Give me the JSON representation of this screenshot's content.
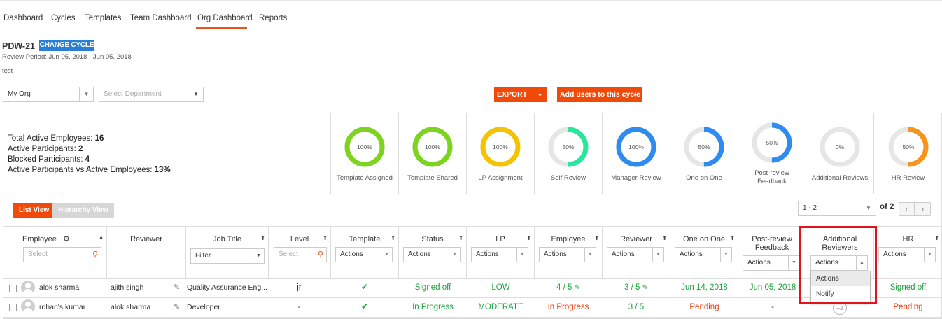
{
  "nav": {
    "tabs": [
      "Dashboard",
      "Cycles",
      "Templates",
      "Team Dashboard",
      "Org Dashboard",
      "Reports"
    ],
    "active": "Org Dashboard"
  },
  "cycle": {
    "name": "PDW-21",
    "change_label": "CHANGE CYCLE",
    "review_period": "Review Period: Jun 05, 2018 - Jun 05, 2018",
    "description": "test"
  },
  "filters": {
    "org_value": "My Org",
    "department_placeholder": "Select Department",
    "export_label": "EXPORT",
    "add_users_label": "Add users to this cycle"
  },
  "stats": [
    {
      "label": "Total Active Employees: ",
      "value": "16"
    },
    {
      "label": "Active Participants: ",
      "value": "2"
    },
    {
      "label": "Blocked Participants: ",
      "value": "4"
    },
    {
      "label": "Active Participants vs Active Employees: ",
      "value": "13%"
    }
  ],
  "metrics": [
    {
      "label": "Template Assigned",
      "pct": "100%",
      "fraction": 1.0,
      "color": "#7ed321"
    },
    {
      "label": "Template Shared",
      "pct": "100%",
      "fraction": 1.0,
      "color": "#7ed321"
    },
    {
      "label": "LP Assignment",
      "pct": "100%",
      "fraction": 1.0,
      "color": "#f5c300"
    },
    {
      "label": "Self Review",
      "pct": "50%",
      "fraction": 0.5,
      "color": "#27e89a"
    },
    {
      "label": "Manager Review",
      "pct": "100%",
      "fraction": 1.0,
      "color": "#2e8bf0"
    },
    {
      "label": "One on One",
      "pct": "50%",
      "fraction": 0.5,
      "color": "#2e8bf0"
    },
    {
      "label": "Post-review Feedback",
      "pct": "50%",
      "fraction": 0.5,
      "color": "#2e8bf0"
    },
    {
      "label": "Additional Reviews",
      "pct": "0%",
      "fraction": 0.0,
      "color": "#2e8bf0"
    },
    {
      "label": "HR Review",
      "pct": "50%",
      "fraction": 0.5,
      "color": "#f7941d"
    }
  ],
  "view_toggle": {
    "list": "List View",
    "hierarchy": "Hierarchy View"
  },
  "pagination": {
    "range": "1 - 2",
    "of": "of 2"
  },
  "table": {
    "employee_header": "Employee",
    "employee_search_placeholder": "Select",
    "reviewer_header": "Reviewer",
    "job_title_header": "Job Title",
    "job_title_filter": "Filter",
    "level_header": "Level",
    "level_placeholder": "Select",
    "cols": [
      {
        "title": "Template",
        "dd": "Actions"
      },
      {
        "title": "Status",
        "dd": "Actions"
      },
      {
        "title": "LP",
        "dd": "Actions"
      },
      {
        "title": "Employee",
        "dd": "Actions"
      },
      {
        "title": "Reviewer",
        "dd": "Actions"
      },
      {
        "title": "One on One",
        "dd": "Actions"
      },
      {
        "title": "Post-review Feedback",
        "dd": "Actions"
      },
      {
        "title": "Additional Reviewers",
        "dd": "Actions"
      },
      {
        "title": "HR",
        "dd": "Actions"
      }
    ],
    "rows": [
      {
        "employee": "alok sharma",
        "reviewer": "ajith singh",
        "job_title": "Quality Assurance Eng...",
        "level": "jr",
        "template": "✔",
        "status": "Signed off",
        "lp": "LOW",
        "employee_review": "4 / 5",
        "reviewer_review": "3 / 5",
        "one_on_one": "Jun 14, 2018",
        "post_review": "Jun 05, 2018",
        "hr": "Signed off"
      },
      {
        "employee": "rohan's kumar",
        "reviewer": "alok sharma",
        "job_title": "Developer",
        "level": "-",
        "template": "✔",
        "status": "In Progress",
        "lp": "MODERATE",
        "employee_review": "In Progress",
        "reviewer_review": "3 / 5",
        "one_on_one": "Pending",
        "post_review": "-",
        "additional": "+2",
        "hr": "Pending"
      }
    ]
  },
  "dropdown_menu": {
    "options": [
      "Actions",
      "Notify"
    ]
  }
}
